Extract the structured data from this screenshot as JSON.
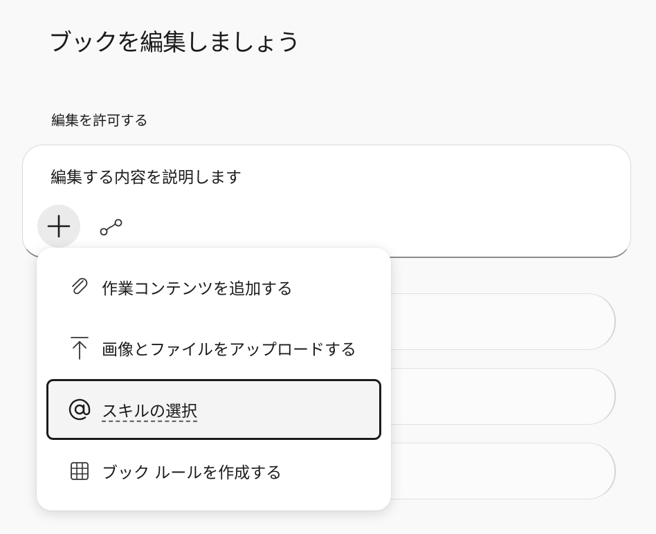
{
  "page": {
    "title": "ブックを編集しましょう",
    "section_label": "編集を許可する"
  },
  "compose": {
    "placeholder": "編集する内容を説明します",
    "icons": {
      "add": "plus-icon",
      "link": "link-icon"
    }
  },
  "menu": {
    "items": [
      {
        "label": "作業コンテンツを追加する",
        "icon": "paperclip-icon",
        "selected": false
      },
      {
        "label": "画像とファイルをアップロードする",
        "icon": "upload-icon",
        "selected": false
      },
      {
        "label": "スキルの選択",
        "icon": "at-sign-icon",
        "selected": true
      },
      {
        "label": "ブック ルールを作成する",
        "icon": "table-grid-icon",
        "selected": false
      }
    ]
  },
  "colors": {
    "background": "#f9f9f9",
    "surface": "#ffffff",
    "text": "#1b1b1b",
    "focus_border": "#1b1b1b",
    "plus_button_bg": "#ebebeb"
  }
}
